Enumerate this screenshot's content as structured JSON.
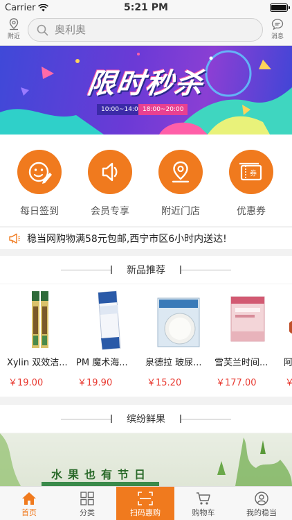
{
  "status_bar": {
    "carrier": "Carrier",
    "time": "5:21 PM"
  },
  "header": {
    "nearby_label": "附近",
    "messages_label": "消息",
    "search_placeholder": "奥利奥"
  },
  "banner": {
    "title": "限时秒杀",
    "time_slot_1": "10:00~14:00",
    "time_slot_2": "18:00~20:00"
  },
  "quick_menu": [
    {
      "label": "每日签到",
      "icon": "smiley-pen-icon"
    },
    {
      "label": "会员专享",
      "icon": "speaker-icon"
    },
    {
      "label": "附近门店",
      "icon": "map-pin-icon"
    },
    {
      "label": "优惠券",
      "icon": "coupon-icon"
    }
  ],
  "coupon_icon_text": "券",
  "notice": {
    "text": "稳当网购物满58元包邮,西宁市区6小时内送达!"
  },
  "new_products": {
    "title": "新品推荐",
    "items": [
      {
        "name": "Xylin 双效洁...",
        "price": "￥19.00"
      },
      {
        "name": "PM 魔术海...",
        "price": "￥19.90"
      },
      {
        "name": "泉德拉 玻尿...",
        "price": "￥15.20"
      },
      {
        "name": "雪芙兰时间...",
        "price": "￥177.00"
      },
      {
        "name": "阿",
        "price": "￥"
      }
    ]
  },
  "fresh_section": {
    "title": "缤纷鲜果",
    "banner_text": "水果也有节日"
  },
  "tabbar": [
    {
      "label": "首页",
      "icon": "home-icon"
    },
    {
      "label": "分类",
      "icon": "grid-icon"
    },
    {
      "label": "扫码惠购",
      "icon": "scan-icon"
    },
    {
      "label": "购物车",
      "icon": "cart-icon"
    },
    {
      "label": "我的稳当",
      "icon": "user-icon"
    }
  ],
  "colors": {
    "accent": "#f07a1e",
    "price": "#e8382f"
  }
}
